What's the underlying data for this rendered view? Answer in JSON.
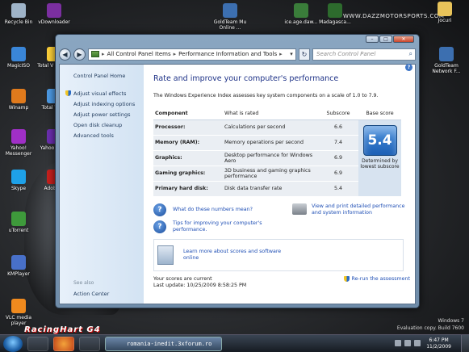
{
  "desktop": {
    "site_text": "WWW.DAZZMOTORSPORTS.COM",
    "icons_left": [
      {
        "label": "Recycle Bin",
        "icon": "recycle-bin-icon",
        "color": "#9fb4c9"
      },
      {
        "label": "vDownloader",
        "icon": "downloader-icon",
        "color": "#7b2fa0"
      },
      {
        "label": "MagicISO",
        "icon": "magiciso-icon",
        "color": "#3a86d8"
      },
      {
        "label": "Total V Comm",
        "icon": "total-commander-icon",
        "color": "#ffd23a"
      },
      {
        "label": "Winamp",
        "icon": "winamp-icon",
        "color": "#e07a1c"
      },
      {
        "label": "Total V Pla",
        "icon": "total-video-player-icon",
        "color": "#4d9be6"
      },
      {
        "label": "Yahoo! Messenger",
        "icon": "yahoo-messenger-icon",
        "color": "#a02fc7"
      },
      {
        "label": "Yahoo Mess",
        "icon": "yahoo-icon",
        "color": "#6c2fb0"
      },
      {
        "label": "Skype",
        "icon": "skype-icon",
        "color": "#1ea1e8"
      },
      {
        "label": "Adobe R",
        "icon": "adobe-reader-icon",
        "color": "#c8201d"
      },
      {
        "label": "uTorrent",
        "icon": "utorrent-icon",
        "color": "#3e9a3b"
      },
      {
        "label": "KMPlayer",
        "icon": "kmplayer-icon",
        "color": "#4870c9"
      },
      {
        "label": "VLC media player",
        "icon": "vlc-icon",
        "color": "#f08a1e"
      }
    ],
    "icons_top": [
      {
        "label": "GoldTeam Mu Online ...",
        "icon": "goldteam-icon",
        "color": "#3c6fb0"
      },
      {
        "label": "ice.age.daw...",
        "icon": "video-file-icon",
        "color": "#3a7d3a"
      },
      {
        "label": "Madagasca...",
        "icon": "video-file-icon",
        "color": "#2d6b2d"
      },
      {
        "label": "Jocuri",
        "icon": "folder-icon",
        "color": "#e8c35a"
      }
    ],
    "icon_right": {
      "label": "GoldTeam Network F...",
      "icon": "goldteam-icon",
      "color": "#3c6fb0"
    },
    "racing_logo": "RacingHart G4",
    "windows_brand": {
      "line1": "Windows 7",
      "line2": "Evaluation copy. Build 7600"
    }
  },
  "window": {
    "controls": {
      "minimize": "–",
      "maximize": "□",
      "close": "✕"
    },
    "nav": {
      "back": "◀",
      "forward": "▶"
    },
    "address": {
      "crumbs": [
        "All Control Panel Items",
        "Performance Information and Tools"
      ],
      "separator": "▸",
      "dropdown": "▾"
    },
    "refresh": "↻",
    "search": {
      "placeholder": "Search Control Panel",
      "icon": "⌕"
    },
    "sidebar": {
      "home": "Control Panel Home",
      "links": [
        "Adjust visual effects",
        "Adjust indexing options",
        "Adjust power settings",
        "Open disk cleanup",
        "Advanced tools"
      ],
      "see_also": "See also",
      "action_center": "Action Center"
    },
    "main": {
      "title": "Rate and improve your computer's performance",
      "intro": "The Windows Experience Index assesses key system components on a scale of 1.0 to 7.9.",
      "help": "?",
      "table": {
        "headers": {
          "component": "Component",
          "what": "What is rated",
          "subscore": "Subscore",
          "base": "Base score"
        },
        "rows": [
          {
            "component": "Processor:",
            "what": "Calculations per second",
            "subscore": "6.6"
          },
          {
            "component": "Memory (RAM):",
            "what": "Memory operations per second",
            "subscore": "7.4"
          },
          {
            "component": "Graphics:",
            "what": "Desktop performance for Windows Aero",
            "subscore": "6.9"
          },
          {
            "component": "Gaming graphics:",
            "what": "3D business and gaming graphics performance",
            "subscore": "6.9"
          },
          {
            "component": "Primary hard disk:",
            "what": "Disk data transfer rate",
            "subscore": "5.4"
          }
        ],
        "base_score": "5.4",
        "determined": "Determined by lowest subscore"
      },
      "help_links": [
        "What do these numbers mean?",
        "Tips for improving your computer's performance."
      ],
      "print_link": "View and print detailed performance and system information",
      "learn_link": "Learn more about scores and software online",
      "status": {
        "current": "Your scores are current",
        "last_update": "Last update: 10/25/2009 8:58:25 PM"
      },
      "rerun": "Re-run the assessment"
    }
  },
  "taskbar": {
    "active_label": "romania-inedit.3xforum.ro",
    "time": "6:47 PM",
    "date": "11/2/2009"
  },
  "colors": {
    "link": "#1f4fb5",
    "title": "#1e3287",
    "badge": "#1b5fb5"
  }
}
